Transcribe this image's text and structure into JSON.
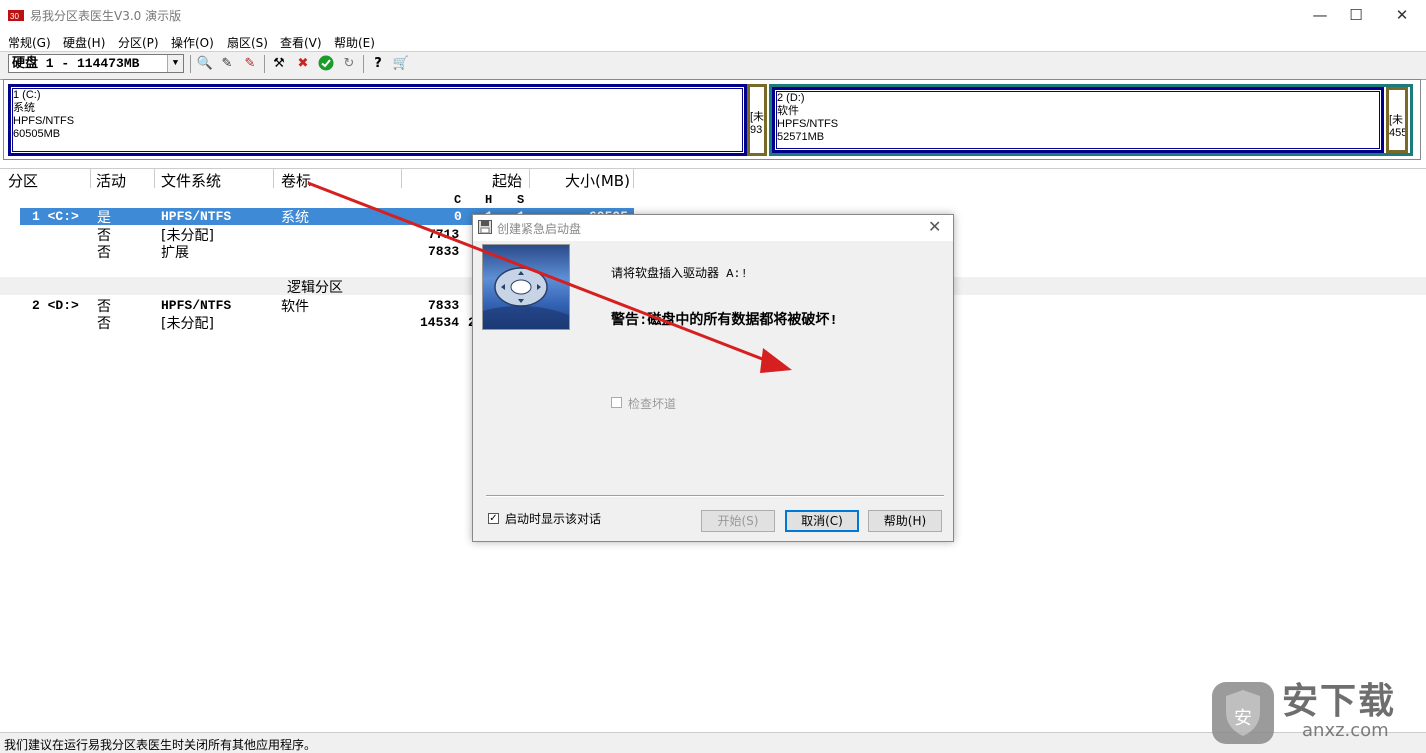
{
  "window": {
    "title": "易我分区表医生V3.0 演示版",
    "minimize": "—",
    "maximize": "☐",
    "close": "✕"
  },
  "menu": [
    "常规(G)",
    "硬盘(H)",
    "分区(P)",
    "操作(O)",
    "扇区(S)",
    "查看(V)",
    "帮助(E)"
  ],
  "toolbar": {
    "disk_select": "硬盘 1 - 114473MB",
    "icons": [
      "search-disk-icon",
      "edit-icon",
      "edit-alt-icon",
      "tools-icon",
      "delete-icon",
      "check-icon",
      "refresh-icon",
      "help-icon",
      "cart-icon"
    ]
  },
  "partition_map": {
    "c": {
      "line1": "1 (C:)",
      "line2": "系统",
      "line3": "HPFS/NTFS",
      "line4": "60505MB"
    },
    "u1": {
      "line1": "[未",
      "line2": "93"
    },
    "d": {
      "line1": "2 (D:)",
      "line2": "软件",
      "line3": "HPFS/NTFS",
      "line4": "52571MB"
    },
    "u2": {
      "line1": "[未",
      "line2": "455"
    }
  },
  "list": {
    "headers": {
      "partition": "分区",
      "active": "活动",
      "fs": "文件系统",
      "label": "卷标",
      "start": "起始",
      "size": "大小(MB)"
    },
    "chs": {
      "c": "C",
      "h": "H",
      "s": "S"
    },
    "rows": [
      {
        "partition": "1 <C:>",
        "active": "是",
        "fs": "HPFS/NTFS",
        "label": "系统",
        "c": "0",
        "h": "1",
        "s": "1",
        "size": "60505"
      },
      {
        "partition": "",
        "active": "否",
        "fs": "[未分配]",
        "label": "",
        "c": "7713",
        "h": "",
        "s": "",
        "size": ""
      },
      {
        "partition": "",
        "active": "否",
        "fs": "扩展",
        "label": "",
        "c": "7833",
        "h": "",
        "s": "",
        "size": ""
      }
    ],
    "logical_title": "逻辑分区",
    "logical_rows": [
      {
        "partition": "2 <D:>",
        "active": "否",
        "fs": "HPFS/NTFS",
        "label": "软件",
        "c": "7833",
        "h": "",
        "s": "",
        "size": ""
      },
      {
        "partition": "",
        "active": "否",
        "fs": "[未分配]",
        "label": "",
        "c": "14534",
        "h": "2",
        "s": "",
        "size": ""
      }
    ]
  },
  "dialog": {
    "title": "创建紧急启动盘",
    "close": "✕",
    "message": "请将软盘插入驱动器 A:!",
    "warning": "警告:磁盘中的所有数据都将被破坏!",
    "check_bad_label": "检查坏道",
    "show_on_start_label": "启动时显示该对话",
    "start_button": "开始(S)",
    "cancel_button": "取消(C)",
    "help_button": "帮助(H)"
  },
  "status": {
    "text": "我们建议在运行易我分区表医生时关闭所有其他应用程序。"
  },
  "watermark": {
    "line1": "安下载",
    "line2": "anxz.com",
    "badge": "安"
  },
  "colors": {
    "partition_border": "#00008b",
    "unallocated": "#7a6a2a",
    "extended": "#1e7b7b",
    "selected_row": "#3f8ad6",
    "arrow": "#d6201f"
  }
}
